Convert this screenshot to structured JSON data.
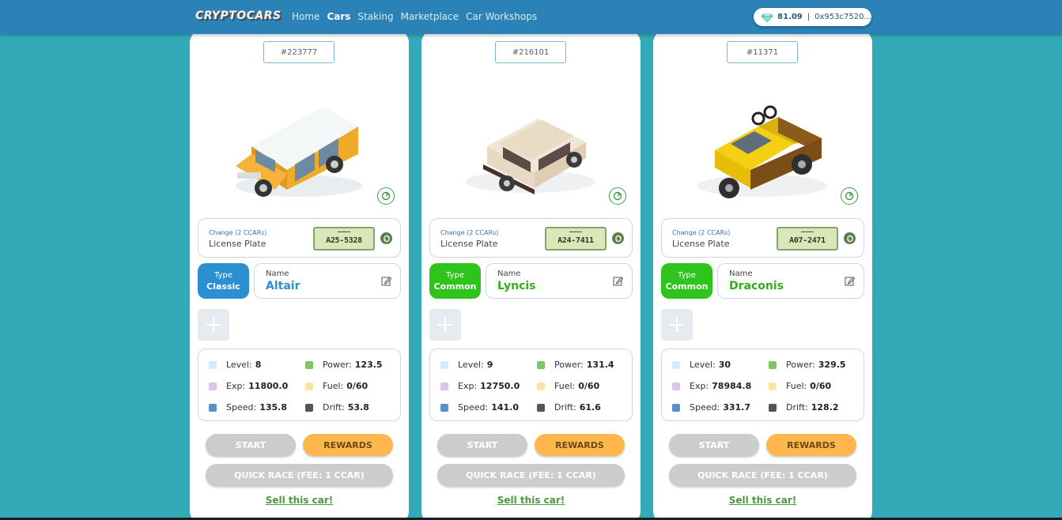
{
  "app": {
    "logo": "CRYPTOCARS",
    "nav": [
      {
        "label": "Home",
        "active": false
      },
      {
        "label": "Cars",
        "active": true
      },
      {
        "label": "Staking",
        "active": false
      },
      {
        "label": "Marketplace",
        "active": false
      },
      {
        "label": "Car Workshops",
        "active": false
      }
    ],
    "wallet": {
      "balance": "81.09",
      "separator": "|",
      "address": "0x953c7520..."
    }
  },
  "cards": [
    {
      "id": "#223777",
      "car_icon": "van-icon",
      "plate_change": "Change (2 CCARs)",
      "plate_label": "License Plate",
      "plate_number": "A25-5328",
      "type_label": "Type",
      "type_value": "Classic",
      "type_color": "#2b8fd0",
      "name_label": "Name",
      "name_value": "Altair",
      "name_color": "#2b8fd0",
      "stats": {
        "level_label": "Level:",
        "level": "8",
        "power_label": "Power:",
        "power": "123.5",
        "exp_label": "Exp:",
        "exp": "11800.0",
        "fuel_label": "Fuel:",
        "fuel": "0/60",
        "speed_label": "Speed:",
        "speed": "135.8",
        "drift_label": "Drift:",
        "drift": "53.8"
      },
      "start_label": "START",
      "rewards_label": "REWARDS",
      "race_label": "QUICK RACE (FEE: 1 CCAR)",
      "sell_label": "Sell this car!"
    },
    {
      "id": "#216101",
      "car_icon": "suv-icon",
      "plate_change": "Change (2 CCARs)",
      "plate_label": "License Plate",
      "plate_number": "A24-7411",
      "type_label": "Type",
      "type_value": "Common",
      "type_color": "#2fc41c",
      "name_label": "Name",
      "name_value": "Lyncis",
      "name_color": "#2fb01a",
      "stats": {
        "level_label": "Level:",
        "level": "9",
        "power_label": "Power:",
        "power": "131.4",
        "exp_label": "Exp:",
        "exp": "12750.0",
        "fuel_label": "Fuel:",
        "fuel": "0/60",
        "speed_label": "Speed:",
        "speed": "141.0",
        "drift_label": "Drift:",
        "drift": "61.6"
      },
      "start_label": "START",
      "rewards_label": "REWARDS",
      "race_label": "QUICK RACE (FEE: 1 CCAR)",
      "sell_label": "Sell this car!"
    },
    {
      "id": "#11371",
      "car_icon": "pickup-truck-icon",
      "plate_change": "Change (2 CCARs)",
      "plate_label": "License Plate",
      "plate_number": "A07-2471",
      "type_label": "Type",
      "type_value": "Common",
      "type_color": "#2fc41c",
      "name_label": "Name",
      "name_value": "Draconis",
      "name_color": "#2fb01a",
      "stats": {
        "level_label": "Level:",
        "level": "30",
        "power_label": "Power:",
        "power": "329.5",
        "exp_label": "Exp:",
        "exp": "78984.8",
        "fuel_label": "Fuel:",
        "fuel": "0/60",
        "speed_label": "Speed:",
        "speed": "331.7",
        "drift_label": "Drift:",
        "drift": "128.2"
      },
      "start_label": "START",
      "rewards_label": "REWARDS",
      "race_label": "QUICK RACE (FEE: 1 CCAR)",
      "sell_label": "Sell this car!"
    }
  ]
}
